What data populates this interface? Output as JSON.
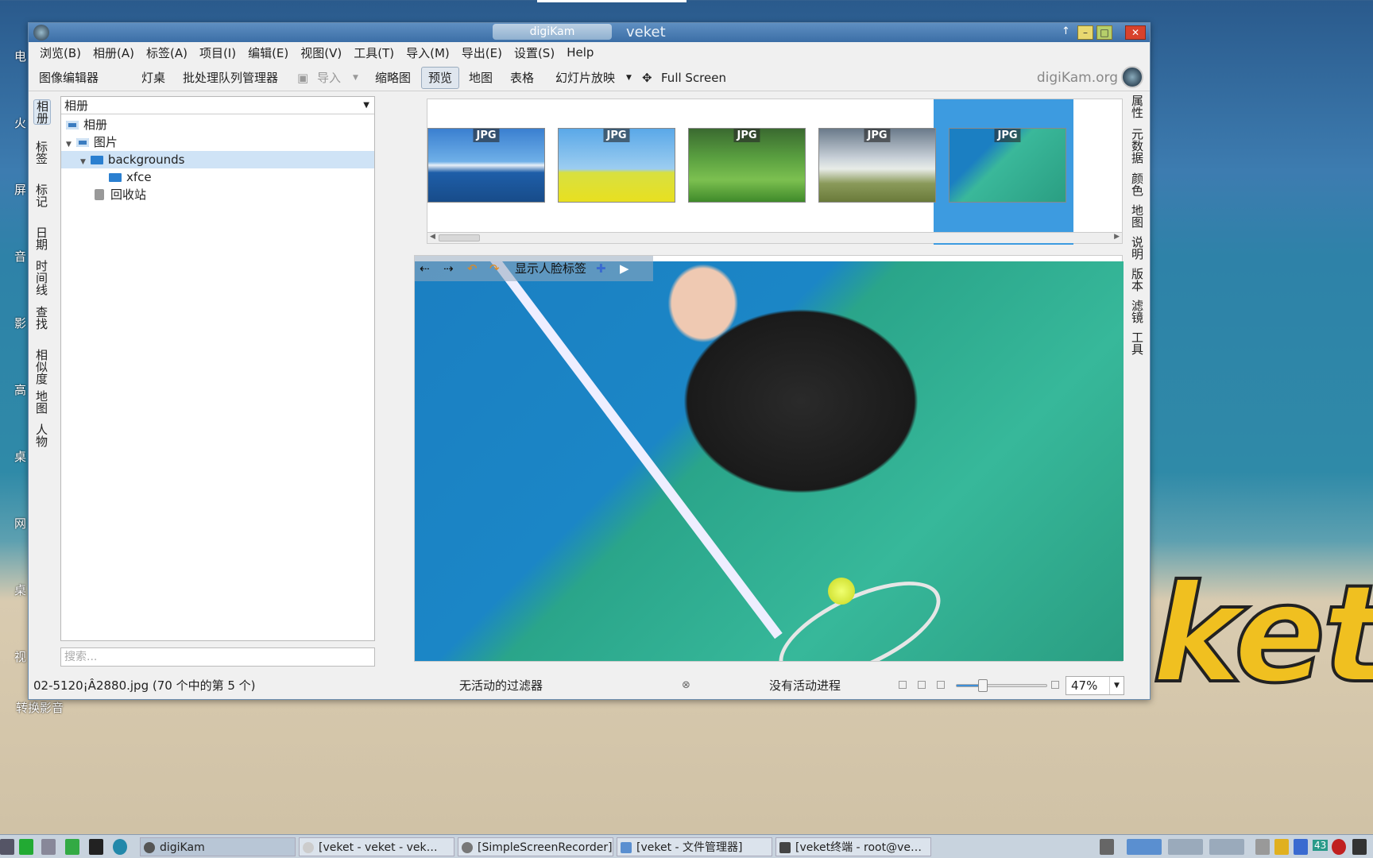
{
  "desktop": {
    "side_labels": [
      "电",
      "火",
      "屏",
      "音",
      "影",
      "高",
      "桌",
      "网",
      "桌",
      "视"
    ],
    "icon_label": "转换影音",
    "logo_text": "ket"
  },
  "window": {
    "tab_title": "digiKam",
    "title": "veket",
    "pin": "↑",
    "min": "–",
    "max": "□",
    "close": "✕"
  },
  "menu": [
    "浏览(B)",
    "相册(A)",
    "标签(A)",
    "项目(I)",
    "编辑(E)",
    "视图(V)",
    "工具(T)",
    "导入(M)",
    "导出(E)",
    "设置(S)",
    "Help"
  ],
  "toolbar": {
    "image_editor": "图像编辑器",
    "light_table": "灯桌",
    "batch_queue": "批处理队列管理器",
    "import": "导入",
    "thumbnails": "缩略图",
    "preview": "预览",
    "map": "地图",
    "table": "表格",
    "slideshow": "幻灯片放映",
    "fullscreen": "Full Screen",
    "brand": "digiKam.org"
  },
  "left_tabs": [
    "相册",
    "标签",
    "标记",
    "日期",
    "时间线",
    "查找",
    "相似度",
    "地图",
    "人物"
  ],
  "right_tabs": [
    "属性",
    "元数据",
    "颜色",
    "地图",
    "说明",
    "版本",
    "滤镜",
    "工具"
  ],
  "tree": {
    "header": "相册",
    "root": "相册",
    "pictures": "图片",
    "backgrounds": "backgrounds",
    "xfce": "xfce",
    "trash": "回收站"
  },
  "search_placeholder": "搜索...",
  "thumbnails": [
    {
      "label": "JPG"
    },
    {
      "label": "JPG"
    },
    {
      "label": "JPG"
    },
    {
      "label": "JPG"
    },
    {
      "label": "JPG"
    }
  ],
  "preview_bar": {
    "back": "⇠",
    "forward": "⇢",
    "face_tags": "显示人脸标签",
    "play": "▶"
  },
  "status": {
    "file": "02-5120¡Â2880.jpg (70 个中的第 5 个)",
    "filter": "无活动的过滤器",
    "process": "没有活动进程",
    "zoom": "47%",
    "zoom_level": 0.47
  },
  "taskbar": {
    "digikam": "digiKam",
    "veket_browser": "[veket - veket - vek…",
    "recorder": "[SimpleScreenRecorder]",
    "filemanager": "[veket - 文件管理器]",
    "terminal": "[veket终端 - root@ve…",
    "tray_num": "43"
  }
}
